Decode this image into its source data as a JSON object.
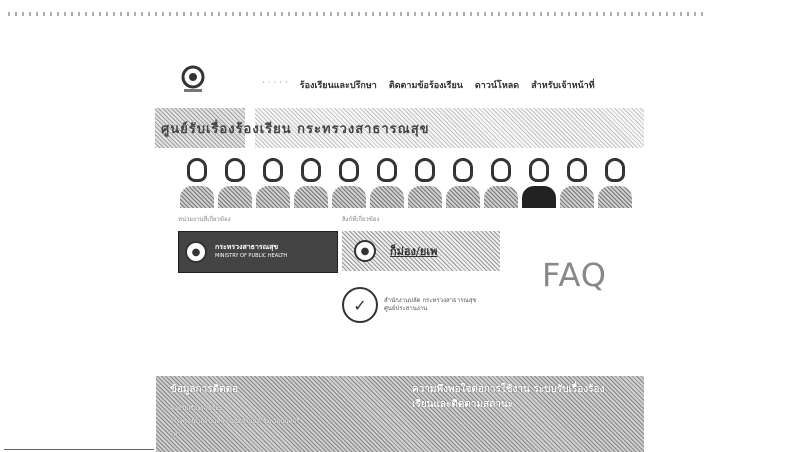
{
  "nav": {
    "items": [
      {
        "label": "· · · · ·",
        "dim": true
      },
      {
        "label": "ร้องเรียนและปรึกษา"
      },
      {
        "label": "ติดตามข้อร้องเรียน"
      },
      {
        "label": "ดาวน์โหลด"
      },
      {
        "label": "สำหรับเจ้าหน้าที่"
      }
    ]
  },
  "banner": {
    "title": "ศูนย์รับเรื่องร้องเรียน กระทรวงสาธารณสุข"
  },
  "sections": {
    "left_label": "หน่วยงานที่เกี่ยวข้อง",
    "right_label": "ลิงก์ที่เกี่ยวข้อง"
  },
  "links": {
    "moph_th": "กระทรวงสาธารณสุข",
    "moph_en": "MINISTRY OF PUBLIC HEALTH",
    "mol_name": "ก็ม่อง/ยเพ",
    "emblem_line1": "สำนักงานปลัด กระทรวงสาธารณสุข",
    "emblem_line2": "ศูนย์ประสานงาน"
  },
  "faq": {
    "label": "FAQ"
  },
  "footer": {
    "left_title": "ข้อมูลการติดต่อ",
    "left_items": [
      "ศูนย์รับเรื่องร้องเรียน",
      "กระทรวงสาธารณสุข ถนนติวานนท์ จังหวัดนนทบุรี",
      "โทร"
    ],
    "right_title": "ความพึงพอใจต่อการใช้งาน ระบบรับเรื่องร้องเรียนและติดตามสถานะ"
  },
  "colors": {
    "moph_bg": "#444444",
    "footer_bg": "#a0a0a0"
  }
}
